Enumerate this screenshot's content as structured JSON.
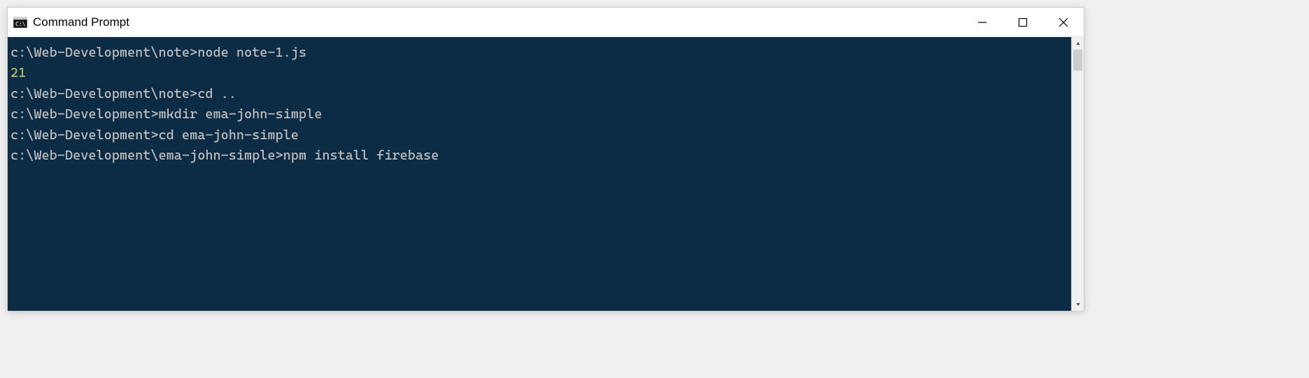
{
  "window": {
    "title": "Command Prompt"
  },
  "terminal": {
    "lines": [
      {
        "prompt": "c:\\Web-Development\\note>",
        "command": "node note-1.js",
        "output": null
      },
      {
        "prompt": null,
        "command": null,
        "output": "21"
      },
      {
        "prompt": null,
        "command": null,
        "output": ""
      },
      {
        "prompt": "c:\\Web-Development\\note>",
        "command": "cd ..",
        "output": null
      },
      {
        "prompt": null,
        "command": null,
        "output": ""
      },
      {
        "prompt": "c:\\Web-Development>",
        "command": "mkdir ema-john-simple",
        "output": null
      },
      {
        "prompt": null,
        "command": null,
        "output": ""
      },
      {
        "prompt": "c:\\Web-Development>",
        "command": "cd ema-john-simple",
        "output": null
      },
      {
        "prompt": null,
        "command": null,
        "output": ""
      },
      {
        "prompt": "c:\\Web-Development\\ema-john-simple>",
        "command": "npm install firebase",
        "output": null
      }
    ]
  },
  "colors": {
    "terminal_bg": "#0c2b45",
    "terminal_fg": "#bdbdbd",
    "output_highlight": "#b5bd68"
  }
}
